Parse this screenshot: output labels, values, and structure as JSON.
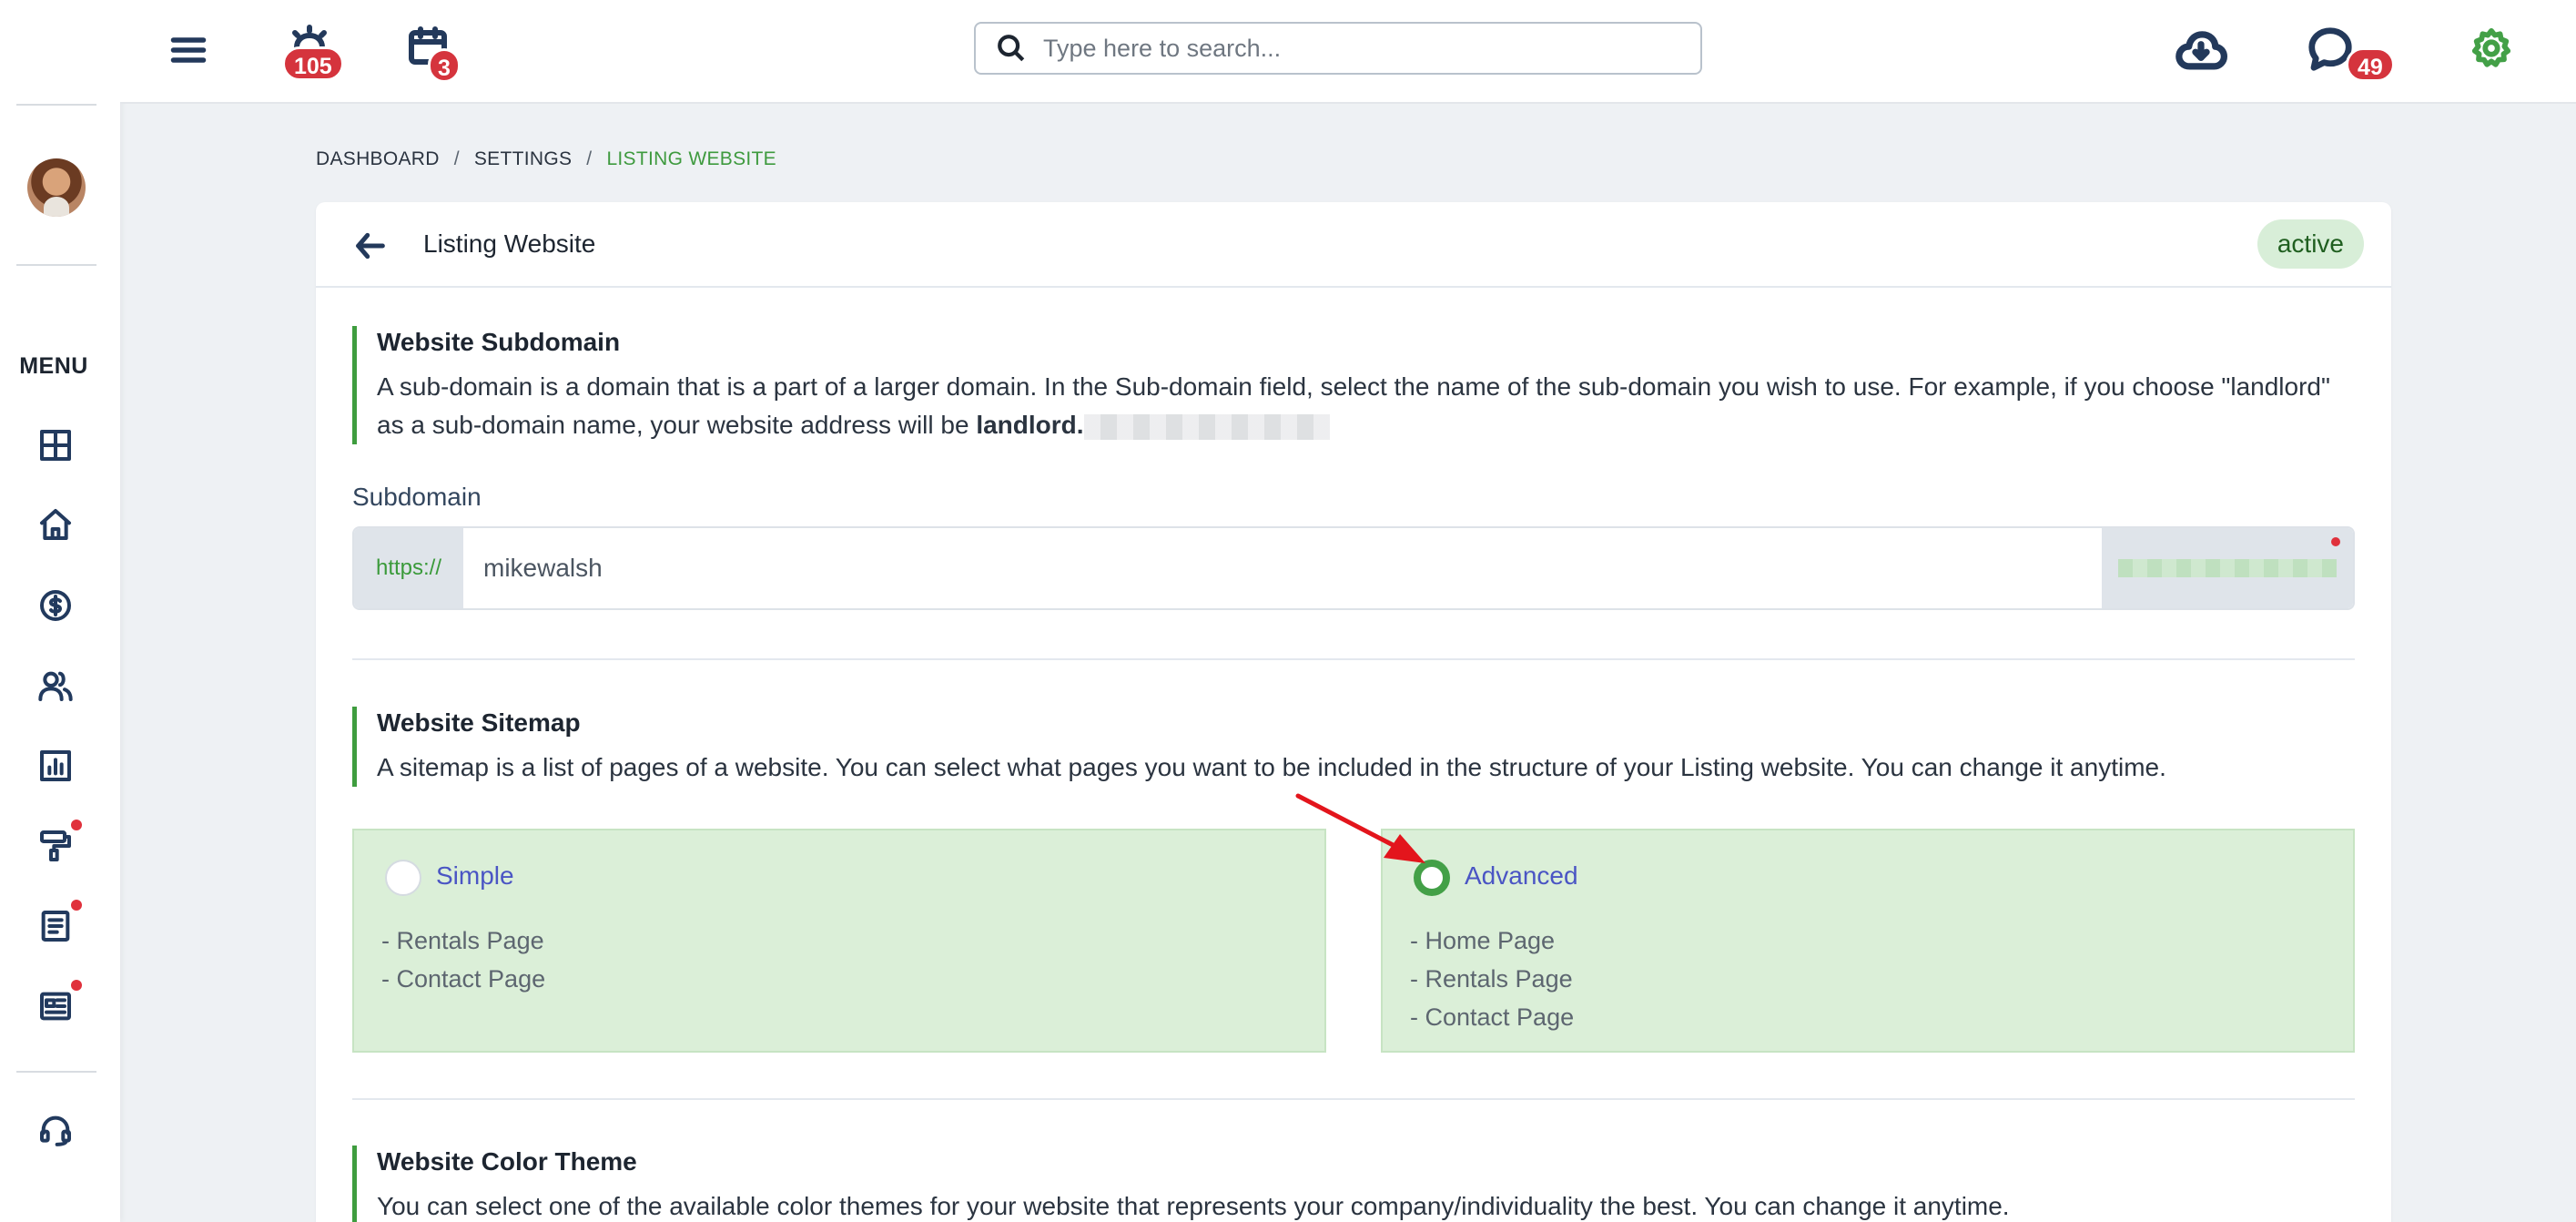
{
  "topbar": {
    "alarm_badge": "105",
    "calendar_badge": "3",
    "search_placeholder": "Type here to search...",
    "chat_badge": "49",
    "settings_color": "#43a047"
  },
  "sidebar": {
    "menu_label": "MENU",
    "items": [
      {
        "icon": "dashboard-icon"
      },
      {
        "icon": "home-icon"
      },
      {
        "icon": "dollar-icon"
      },
      {
        "icon": "users-icon"
      },
      {
        "icon": "chart-icon"
      },
      {
        "icon": "paint-roller-icon"
      },
      {
        "icon": "document-icon"
      },
      {
        "icon": "newspaper-icon"
      },
      {
        "icon": "headset-icon"
      }
    ]
  },
  "breadcrumb": {
    "items": [
      "DASHBOARD",
      "SETTINGS",
      "LISTING WEBSITE"
    ],
    "separator": "/"
  },
  "card": {
    "title": "Listing Website",
    "status": "active"
  },
  "subdomain_section": {
    "title": "Website Subdomain",
    "desc_part1": "A sub-domain is a domain that is a part of a larger domain. In the Sub-domain field, select the name of the sub-domain you wish to use. For example, if you choose \"landlord\" as a sub-domain name, your website address will be ",
    "desc_bold": "landlord.",
    "field_label": "Subdomain",
    "prefix": "https://",
    "value": "mikewalsh"
  },
  "sitemap_section": {
    "title": "Website Sitemap",
    "desc": "A sitemap is a list of pages of a website. You can select what pages you want to be included in the structure of your Listing website. You can change it anytime.",
    "options": [
      {
        "label": "Simple",
        "selected": false,
        "pages": [
          "- Rentals Page",
          "- Contact Page"
        ]
      },
      {
        "label": "Advanced",
        "selected": true,
        "pages": [
          "- Home Page",
          "- Rentals Page",
          "- Contact Page"
        ]
      }
    ]
  },
  "color_section": {
    "title": "Website Color Theme",
    "desc": "You can select one of the available color themes for your website that represents your company/individuality the best. You can change it anytime."
  }
}
